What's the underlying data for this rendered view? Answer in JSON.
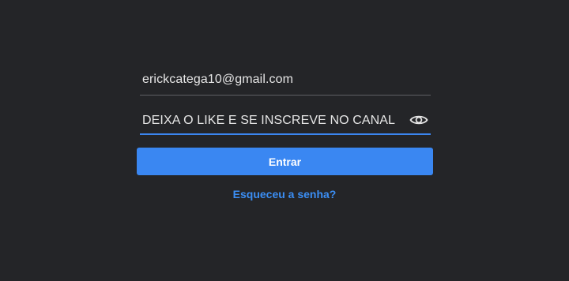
{
  "login": {
    "email_value": "erickcatega10@gmail.com",
    "password_value": "DEIXA O LIKE E SE INSCREVE NO CANAL",
    "submit_label": "Entrar",
    "forgot_password_label": "Esqueceu a senha?"
  },
  "icons": {
    "password_toggle": "eye-icon"
  },
  "colors": {
    "background": "#242528",
    "accent": "#3a87f2",
    "link": "#3b8ef4",
    "text": "#e6e6e6",
    "underline_inactive": "#5f6064"
  }
}
